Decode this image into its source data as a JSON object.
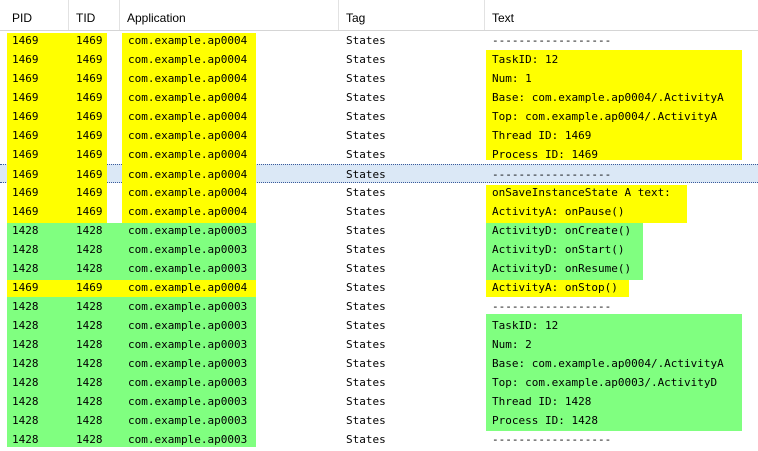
{
  "colors": {
    "yellow": "#ffff00",
    "green": "#80ff80",
    "selected_row": "#dbe8f6"
  },
  "columns": [
    {
      "key": "pid",
      "label": "PID"
    },
    {
      "key": "tid",
      "label": "TID"
    },
    {
      "key": "app",
      "label": "Application"
    },
    {
      "key": "tag",
      "label": "Tag"
    },
    {
      "key": "text",
      "label": "Text"
    }
  ],
  "selected_row_index": 7,
  "rows": [
    {
      "pid": "1469",
      "tid": "1469",
      "app": "com.example.ap0004",
      "tag": "States",
      "text": "------------------"
    },
    {
      "pid": "1469",
      "tid": "1469",
      "app": "com.example.ap0004",
      "tag": "States",
      "text": "TaskID: 12"
    },
    {
      "pid": "1469",
      "tid": "1469",
      "app": "com.example.ap0004",
      "tag": "States",
      "text": "Num: 1"
    },
    {
      "pid": "1469",
      "tid": "1469",
      "app": "com.example.ap0004",
      "tag": "States",
      "text": "Base: com.example.ap0004/.ActivityA"
    },
    {
      "pid": "1469",
      "tid": "1469",
      "app": "com.example.ap0004",
      "tag": "States",
      "text": "Top: com.example.ap0004/.ActivityA"
    },
    {
      "pid": "1469",
      "tid": "1469",
      "app": "com.example.ap0004",
      "tag": "States",
      "text": "Thread ID: 1469"
    },
    {
      "pid": "1469",
      "tid": "1469",
      "app": "com.example.ap0004",
      "tag": "States",
      "text": "Process ID: 1469"
    },
    {
      "pid": "1469",
      "tid": "1469",
      "app": "com.example.ap0004",
      "tag": "States",
      "text": "------------------"
    },
    {
      "pid": "1469",
      "tid": "1469",
      "app": "com.example.ap0004",
      "tag": "States",
      "text": "onSaveInstanceState A text:"
    },
    {
      "pid": "1469",
      "tid": "1469",
      "app": "com.example.ap0004",
      "tag": "States",
      "text": "ActivityA: onPause()"
    },
    {
      "pid": "1428",
      "tid": "1428",
      "app": "com.example.ap0003",
      "tag": "States",
      "text": "ActivityD: onCreate()"
    },
    {
      "pid": "1428",
      "tid": "1428",
      "app": "com.example.ap0003",
      "tag": "States",
      "text": "ActivityD: onStart()"
    },
    {
      "pid": "1428",
      "tid": "1428",
      "app": "com.example.ap0003",
      "tag": "States",
      "text": "ActivityD: onResume()"
    },
    {
      "pid": "1469",
      "tid": "1469",
      "app": "com.example.ap0004",
      "tag": "States",
      "text": "ActivityA: onStop()"
    },
    {
      "pid": "1428",
      "tid": "1428",
      "app": "com.example.ap0003",
      "tag": "States",
      "text": "------------------"
    },
    {
      "pid": "1428",
      "tid": "1428",
      "app": "com.example.ap0003",
      "tag": "States",
      "text": "TaskID: 12"
    },
    {
      "pid": "1428",
      "tid": "1428",
      "app": "com.example.ap0003",
      "tag": "States",
      "text": "Num: 2"
    },
    {
      "pid": "1428",
      "tid": "1428",
      "app": "com.example.ap0003",
      "tag": "States",
      "text": "Base: com.example.ap0004/.ActivityA"
    },
    {
      "pid": "1428",
      "tid": "1428",
      "app": "com.example.ap0003",
      "tag": "States",
      "text": "Top: com.example.ap0003/.ActivityD"
    },
    {
      "pid": "1428",
      "tid": "1428",
      "app": "com.example.ap0003",
      "tag": "States",
      "text": "Thread ID: 1428"
    },
    {
      "pid": "1428",
      "tid": "1428",
      "app": "com.example.ap0003",
      "tag": "States",
      "text": "Process ID: 1428"
    },
    {
      "pid": "1428",
      "tid": "1428",
      "app": "com.example.ap0003",
      "tag": "States",
      "text": "------------------"
    }
  ]
}
